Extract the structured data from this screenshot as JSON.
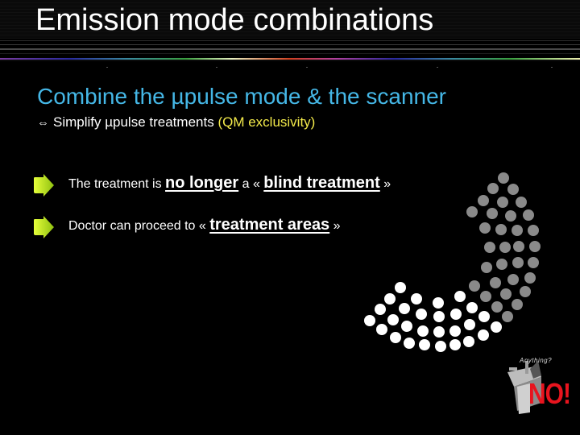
{
  "slide": {
    "title": "Emission mode combinations",
    "subtitle": "Combine the µpulse mode & the scanner",
    "sub_point": {
      "arrow_icon": "left-right-arrow-icon",
      "arrow_glyph": "⇔",
      "text": "Simplify µpulse treatments ",
      "highlight": "(QM exclusivity)"
    },
    "bullets": [
      {
        "icon": "green-arrow-bullet-icon",
        "parts": [
          "The treatment is ",
          "no longer",
          " a « ",
          "blind treatment",
          " »"
        ]
      },
      {
        "icon": "green-arrow-bullet-icon",
        "parts": [
          "Doctor can proceed to « ",
          "treatment areas",
          " »"
        ]
      }
    ],
    "graphic": {
      "name": "scan-dot-arc",
      "gray_color": "#8a8a8a",
      "white_color": "#ffffff"
    },
    "no_badge": {
      "caption": "Anything?",
      "text": "NO!",
      "color": "#e8141e"
    }
  },
  "colors": {
    "background": "#000000",
    "title": "#ffffff",
    "subtitle": "#45b7e6",
    "highlight": "#f2e94a",
    "bullet": "#c8f01e"
  }
}
